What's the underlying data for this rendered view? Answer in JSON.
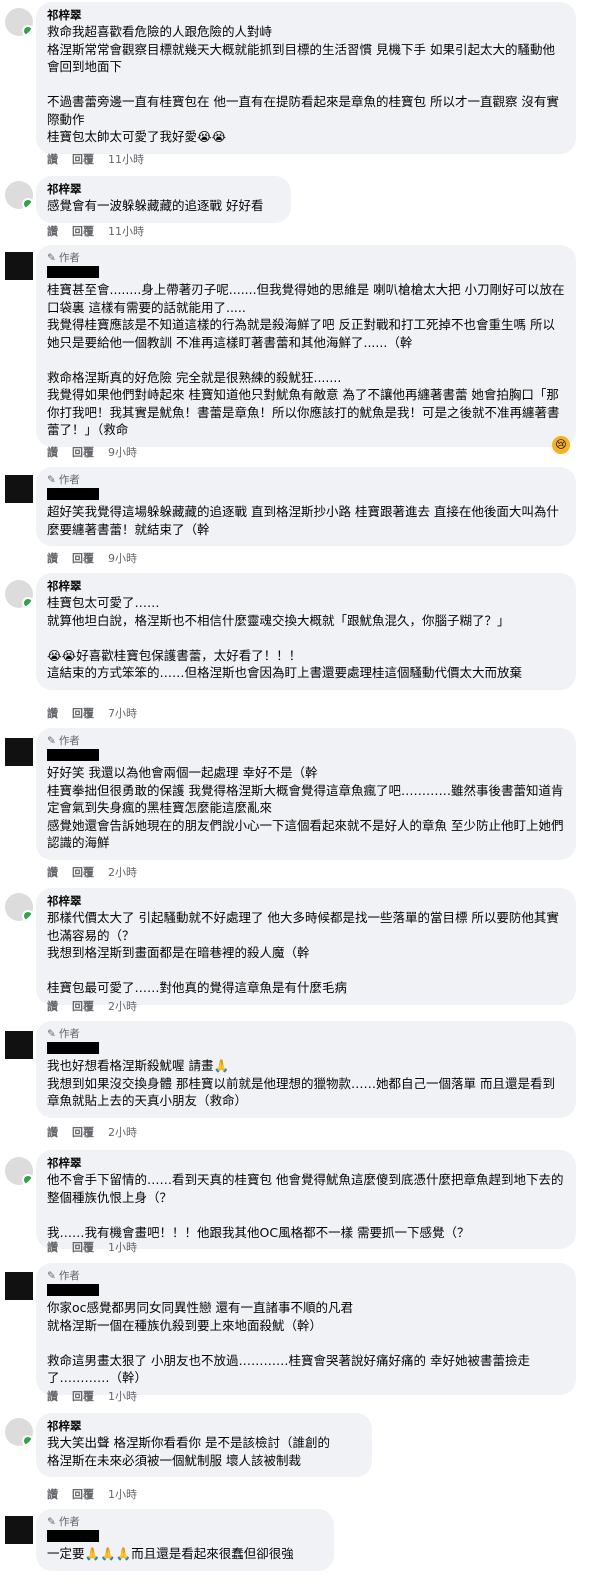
{
  "actions": {
    "reply_like": "讚",
    "reply": "回覆"
  },
  "author_badge": "作者",
  "comments": [
    {
      "name": "祁梓翠",
      "text": "救命我超喜歡看危險的人跟危險的人對峙\n格涅斯常常會觀察目標就幾天大概就能抓到目標的生活習慣 見機下手 如果引起太大的騷動他會回到地面下\n\n不過書蕾旁邊一直有桂寶包在 他一直有在提防看起來是章魚的桂寶包 所以才一直觀察 沒有實際動作\n桂寶包太帥太可愛了我好愛😭😭",
      "time": "11小時"
    },
    {
      "name": "祁梓翠",
      "text": "感覺會有一波躲躲藏藏的追逐戰 好好看",
      "time": "11小時"
    },
    {
      "text": "桂寶甚至會........身上帶著刃子呢.......但我覺得她的思維是 喇叭槍槍太大把 小刀剛好可以放在口袋裏 這樣有需要的話就能用了.....\n我覺得桂寶應該是不知道這樣的行為就是殺海鮮了吧 反正對戰和打工死掉不也會重生嗎 所以她只是要給他一個教訓 不准再這樣盯著書蕾和其他海鮮了......（幹\n\n救命格涅斯真的好危險 完全就是很熟練的殺魷狂.......\n我覺得如果他們對峙起來 桂寶知道他只對魷魚有敵意 為了不讓他再纏著書蕾 她會拍胸口「那你打我吧！我其實是魷魚！書蕾是章魚！所以你應該打的魷魚是我！可是之後就不准再纏著書蕾了！」（救命",
      "time": "9小時",
      "reaction": "😢"
    },
    {
      "text": "超好笑我覺得這場躲躲藏藏的追逐戰 直到格涅斯抄小路 桂寶跟著進去 直接在他後面大叫為什麼要纏著書蕾！就結束了（幹",
      "time": "9小時"
    },
    {
      "name": "祁梓翠",
      "text": "桂寶包太可愛了……\n就算他坦白說，格涅斯也不相信什麼靈魂交換大概就「跟魷魚混久，你腦子糊了？」\n\n😭😭好喜歡桂寶包保護書蕾，太好看了！！！\n這結束的方式笨笨的……但格涅斯也會因為盯上書還要處理桂這個騷動代價太大而放棄",
      "time": "7小時"
    },
    {
      "text": "好好笑 我還以為他會兩個一起處理 幸好不是（幹\n桂寶拳拙但很勇敢的保護 我覺得格涅斯大概會覺得這章魚瘋了吧…………雖然事後書蕾知道肯定會氣到失身瘋的黑桂寶怎麼能這麼亂來\n感覺她還會告訴她現在的朋友們說小心一下這個看起來就不是好人的章魚 至少防止他盯上她們認識的海鮮",
      "time": "2小時"
    },
    {
      "name": "祁梓翠",
      "text": "那樣代價太大了 引起騷動就不好處理了 他大多時候都是找一些落單的當目標 所以要防他其實也滿容易的（？\n我想到格涅斯到畫面都是在暗巷裡的殺人魔（幹\n\n桂寶包最可愛了……對他真的覺得這章魚是有什麼毛病",
      "time": "2小時"
    },
    {
      "text": "我也好想看格涅斯殺魷喔 請畫🙏\n我想到如果沒交換身體 那桂寶以前就是他理想的獵物款……她都自己一個落單 而且還是看到章魚就貼上去的天真小朋友（救命）",
      "time": "2小時"
    },
    {
      "name": "祁梓翠",
      "text": "他不會手下留情的……看到天真的桂寶包 他會覺得魷魚這麼傻到底憑什麼把章魚趕到地下去的整個種族仇恨上身（？\n\n我……我有機會畫吧！！！他跟我其他OC風格都不一樣 需要抓一下感覺（？",
      "time": "1小時"
    },
    {
      "text": "你家oc感覺都男同女同異性戀 還有一直諸事不順的凡君\n就格涅斯一個在種族仇殺到要上來地面殺魷（幹）\n\n救命這男畫太狠了 小朋友也不放過…………桂寶會哭著說好痛好痛的 幸好她被書蕾撿走了…………（幹）",
      "time": "1小時"
    },
    {
      "name": "祁梓翠",
      "text": "我大笑出聲 格涅斯你看看你 是不是該檢討（誰創的\n格涅斯在未來必須被一個魷制服 壞人該被制裁",
      "time": "1小時"
    },
    {
      "text": "一定要🙏🙏🙏而且還是看起來很蠢但卻很強"
    }
  ]
}
